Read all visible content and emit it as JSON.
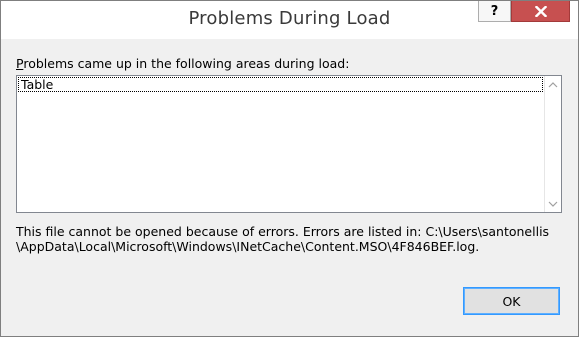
{
  "window": {
    "title": "Problems During Load",
    "help_label": "?",
    "close_icon": "close-icon"
  },
  "prompt": {
    "accelerator": "P",
    "rest": "roblems came up in the following areas during load:"
  },
  "problems_list": {
    "items": [
      "Table"
    ]
  },
  "message": {
    "text": "This file cannot be opened because of errors.  Errors are listed in: C:\\Users\\santonellis\\AppData\\Local\\Microsoft\\Windows\\INetCache\\Content.MSO\\4F846BEF.log."
  },
  "buttons": {
    "ok_label": "OK"
  },
  "colors": {
    "close_button": "#c75050",
    "focus_border": "#3399ff",
    "dialog_bg": "#f0f0f0"
  }
}
